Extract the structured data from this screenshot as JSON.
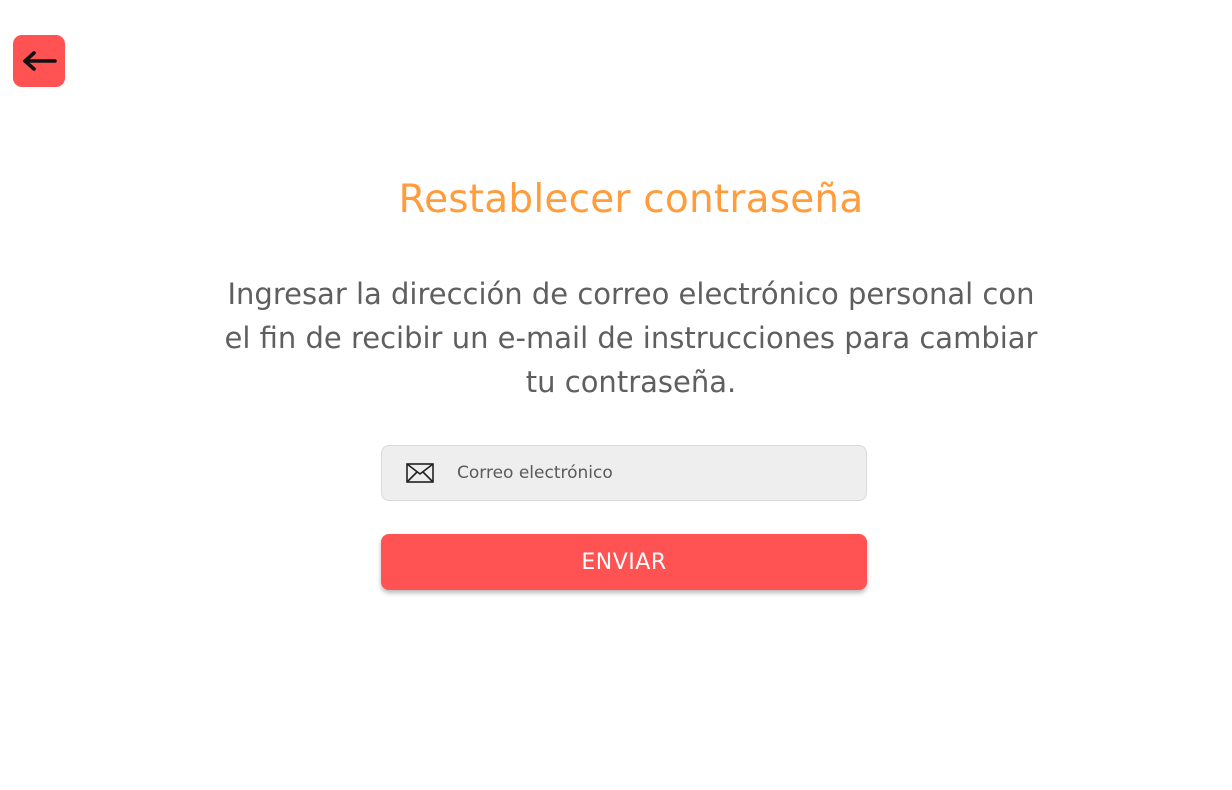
{
  "header": {
    "back_icon": "arrow-left-icon"
  },
  "main": {
    "title": "Restablecer contraseña",
    "description": "Ingresar la dirección de correo electrónico personal con el fin de recibir un e-mail de instrucciones para cambiar tu contraseña.",
    "email_field": {
      "icon": "envelope-icon",
      "placeholder": "Correo electrónico",
      "value": ""
    },
    "submit_label": "ENVIAR"
  },
  "colors": {
    "accent": "#ff5252",
    "title": "#ff9d3d",
    "text": "#5f5f5f",
    "input_bg": "#eeeeee"
  }
}
